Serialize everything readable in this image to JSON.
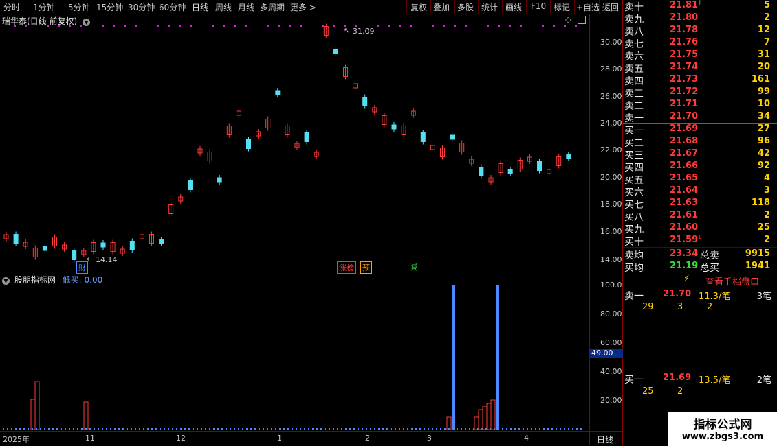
{
  "toolbar": {
    "left_items": [
      "分时",
      "1分钟",
      "5分钟",
      "15分钟",
      "30分钟",
      "60分钟",
      "日线",
      "周线",
      "月线",
      "多周期",
      "更多 >"
    ],
    "right_items": [
      "复权",
      "叠加",
      "多股",
      "统计",
      "画线",
      "F10",
      "标记",
      "+自选",
      "返回"
    ]
  },
  "main_chart": {
    "title": "瑞华泰(日线 前复权)",
    "high_label": "31.09",
    "low_label": "14.14",
    "y_ticks": [
      "30.00",
      "28.00",
      "26.00",
      "24.00",
      "22.00",
      "20.00",
      "18.00",
      "16.00",
      "14.00"
    ],
    "tags": [
      {
        "text": "财",
        "color": "#4a8cff"
      },
      {
        "text": "涨榜",
        "color": "#ff3b3b"
      },
      {
        "text": "预",
        "color": "#ffa000"
      },
      {
        "text": "减",
        "color": "#33cc33"
      }
    ]
  },
  "sub_chart": {
    "title": "股朋指标网",
    "indicator": "低买: 0.00",
    "y_ticks": [
      "100.0",
      "80.00",
      "60.00",
      "40.00",
      "20.00"
    ],
    "current_value": "49.00"
  },
  "x_axis": {
    "labels": [
      "2025年",
      "11",
      "12",
      "1",
      "2",
      "3",
      "4"
    ],
    "period": "日线"
  },
  "order_book": {
    "sell": [
      {
        "label": "卖十",
        "price": "21.81",
        "volume": "5",
        "arrow": "up"
      },
      {
        "label": "卖九",
        "price": "21.80",
        "volume": "2"
      },
      {
        "label": "卖八",
        "price": "21.78",
        "volume": "12"
      },
      {
        "label": "卖七",
        "price": "21.76",
        "volume": "7"
      },
      {
        "label": "卖六",
        "price": "21.75",
        "volume": "31"
      },
      {
        "label": "卖五",
        "price": "21.74",
        "volume": "20"
      },
      {
        "label": "卖四",
        "price": "21.73",
        "volume": "161"
      },
      {
        "label": "卖三",
        "price": "21.72",
        "volume": "99"
      },
      {
        "label": "卖二",
        "price": "21.71",
        "volume": "10"
      },
      {
        "label": "卖一",
        "price": "21.70",
        "volume": "34"
      }
    ],
    "buy": [
      {
        "label": "买一",
        "price": "21.69",
        "volume": "27"
      },
      {
        "label": "买二",
        "price": "21.68",
        "volume": "96"
      },
      {
        "label": "买三",
        "price": "21.67",
        "volume": "42"
      },
      {
        "label": "买四",
        "price": "21.66",
        "volume": "92"
      },
      {
        "label": "买五",
        "price": "21.65",
        "volume": "4"
      },
      {
        "label": "买六",
        "price": "21.64",
        "volume": "3"
      },
      {
        "label": "买七",
        "price": "21.63",
        "volume": "118"
      },
      {
        "label": "买八",
        "price": "21.61",
        "volume": "2"
      },
      {
        "label": "买九",
        "price": "21.60",
        "volume": "25"
      },
      {
        "label": "买十",
        "price": "21.59",
        "volume": "2",
        "arrow": "down"
      }
    ],
    "sell_avg": {
      "label": "卖均",
      "price": "23.34",
      "total_label": "总卖",
      "total": "9915"
    },
    "buy_avg": {
      "label": "买均",
      "price": "21.19",
      "total_label": "总买",
      "total": "1941"
    },
    "view_button": "查看千档盘口",
    "queue_sell": {
      "label": "卖一",
      "price": "21.70",
      "avg": "11.3/笔",
      "count": "3笔",
      "orders": [
        "29",
        "3",
        "2"
      ]
    },
    "queue_buy": {
      "label": "买一",
      "price": "21.69",
      "avg": "13.5/笔",
      "count": "2笔",
      "orders": [
        "25",
        "2"
      ]
    }
  },
  "watermark": {
    "title": "指标公式网",
    "url": "www.zbgs3.com"
  },
  "colors": {
    "up": "#ff3b3b",
    "down": "#54e0f0",
    "frame": "#8a0000",
    "accent": "#ffd200",
    "bar_blue": "#4a8cff"
  }
}
